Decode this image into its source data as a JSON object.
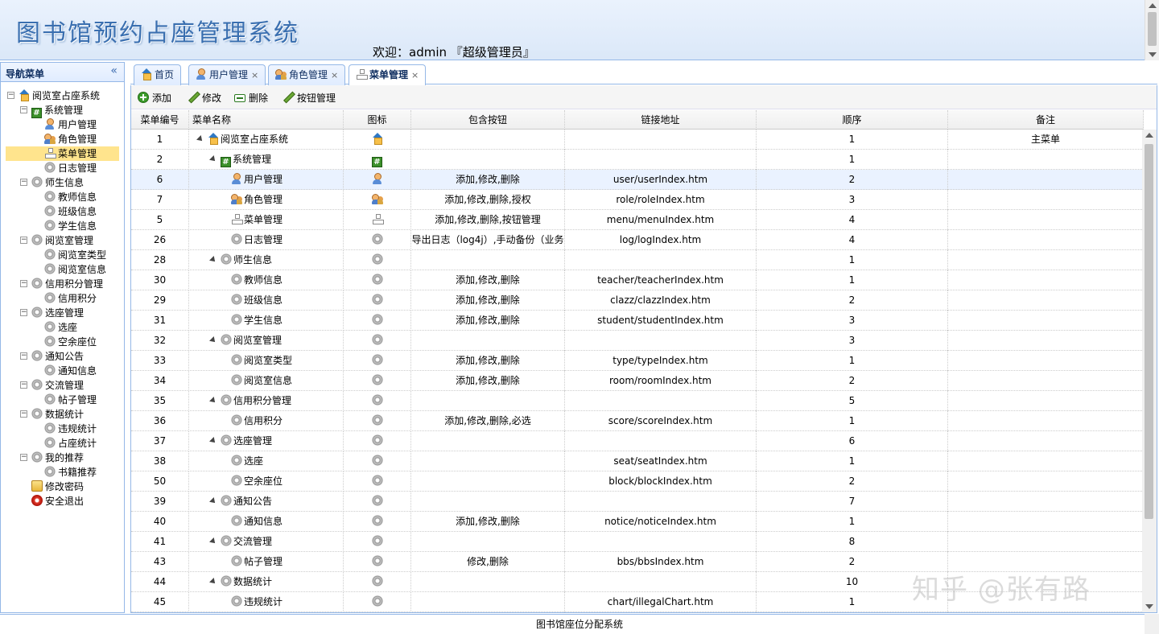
{
  "header": {
    "app_title": "图书馆预约占座管理系统",
    "welcome": "欢迎：admin 『超级管理员』"
  },
  "sidebar": {
    "title": "导航菜单",
    "collapse_glyph": "«",
    "nodes": [
      {
        "label": "阅览室占座系统",
        "icon": "home",
        "level": 0,
        "toggle": "−"
      },
      {
        "label": "系统管理",
        "icon": "hash",
        "level": 1,
        "toggle": "−"
      },
      {
        "label": "用户管理",
        "icon": "user",
        "level": 2
      },
      {
        "label": "角色管理",
        "icon": "role",
        "level": 2
      },
      {
        "label": "菜单管理",
        "icon": "menu",
        "level": 2,
        "selected": true
      },
      {
        "label": "日志管理",
        "icon": "gear",
        "level": 2
      },
      {
        "label": "师生信息",
        "icon": "gear",
        "level": 1,
        "toggle": "−"
      },
      {
        "label": "教师信息",
        "icon": "gear",
        "level": 2
      },
      {
        "label": "班级信息",
        "icon": "gear",
        "level": 2
      },
      {
        "label": "学生信息",
        "icon": "gear",
        "level": 2
      },
      {
        "label": "阅览室管理",
        "icon": "gear",
        "level": 1,
        "toggle": "−"
      },
      {
        "label": "阅览室类型",
        "icon": "gear",
        "level": 2
      },
      {
        "label": "阅览室信息",
        "icon": "gear",
        "level": 2
      },
      {
        "label": "信用积分管理",
        "icon": "gear",
        "level": 1,
        "toggle": "−"
      },
      {
        "label": "信用积分",
        "icon": "gear",
        "level": 2
      },
      {
        "label": "选座管理",
        "icon": "gear",
        "level": 1,
        "toggle": "−"
      },
      {
        "label": "选座",
        "icon": "gear",
        "level": 2
      },
      {
        "label": "空余座位",
        "icon": "gear",
        "level": 2
      },
      {
        "label": "通知公告",
        "icon": "gear",
        "level": 1,
        "toggle": "−"
      },
      {
        "label": "通知信息",
        "icon": "gear",
        "level": 2
      },
      {
        "label": "交流管理",
        "icon": "gear",
        "level": 1,
        "toggle": "−"
      },
      {
        "label": "帖子管理",
        "icon": "gear",
        "level": 2
      },
      {
        "label": "数据统计",
        "icon": "gear",
        "level": 1,
        "toggle": "−"
      },
      {
        "label": "违规统计",
        "icon": "gear",
        "level": 2
      },
      {
        "label": "占座统计",
        "icon": "gear",
        "level": 2
      },
      {
        "label": "我的推荐",
        "icon": "gear",
        "level": 1,
        "toggle": "−"
      },
      {
        "label": "书籍推荐",
        "icon": "gear",
        "level": 2
      },
      {
        "label": "修改密码",
        "icon": "key",
        "level": 1
      },
      {
        "label": "安全退出",
        "icon": "exit",
        "level": 1
      }
    ]
  },
  "tabs": [
    {
      "label": "首页",
      "icon": "home",
      "closable": false
    },
    {
      "label": "用户管理",
      "icon": "user",
      "closable": true
    },
    {
      "label": "角色管理",
      "icon": "role",
      "closable": true
    },
    {
      "label": "菜单管理",
      "icon": "menu",
      "closable": true,
      "active": true
    }
  ],
  "tab_close_glyph": "×",
  "toolbar": {
    "add": "添加",
    "edit": "修改",
    "delete": "删除",
    "button_manage": "按钮管理"
  },
  "grid": {
    "columns": [
      "菜单编号",
      "菜单名称",
      "图标",
      "包含按钮",
      "链接地址",
      "顺序",
      "备注"
    ],
    "rows": [
      {
        "id": "1",
        "name": "阅览室占座系统",
        "level": 0,
        "icon": "home",
        "buttons": "",
        "url": "",
        "order": "1",
        "remark": "主菜单",
        "expand": true
      },
      {
        "id": "2",
        "name": "系统管理",
        "level": 1,
        "icon": "hash",
        "buttons": "",
        "url": "",
        "order": "1",
        "remark": "",
        "expand": true
      },
      {
        "id": "6",
        "name": "用户管理",
        "level": 2,
        "icon": "user",
        "buttons": "添加,修改,删除",
        "url": "user/userIndex.htm",
        "order": "2",
        "remark": "",
        "highlight": true
      },
      {
        "id": "7",
        "name": "角色管理",
        "level": 2,
        "icon": "role",
        "buttons": "添加,修改,删除,授权",
        "url": "role/roleIndex.htm",
        "order": "3",
        "remark": ""
      },
      {
        "id": "5",
        "name": "菜单管理",
        "level": 2,
        "icon": "menu",
        "buttons": "添加,修改,删除,按钮管理",
        "url": "menu/menuIndex.htm",
        "order": "4",
        "remark": ""
      },
      {
        "id": "26",
        "name": "日志管理",
        "level": 2,
        "icon": "gear",
        "buttons": "导出日志（log4j）,手动备份（业务",
        "url": "log/logIndex.htm",
        "order": "4",
        "remark": ""
      },
      {
        "id": "28",
        "name": "师生信息",
        "level": 1,
        "icon": "gear",
        "buttons": "",
        "url": "",
        "order": "1",
        "remark": "",
        "expand": true
      },
      {
        "id": "30",
        "name": "教师信息",
        "level": 2,
        "icon": "gear",
        "buttons": "添加,修改,删除",
        "url": "teacher/teacherIndex.htm",
        "order": "1",
        "remark": ""
      },
      {
        "id": "29",
        "name": "班级信息",
        "level": 2,
        "icon": "gear",
        "buttons": "添加,修改,删除",
        "url": "clazz/clazzIndex.htm",
        "order": "2",
        "remark": ""
      },
      {
        "id": "31",
        "name": "学生信息",
        "level": 2,
        "icon": "gear",
        "buttons": "添加,修改,删除",
        "url": "student/studentIndex.htm",
        "order": "3",
        "remark": ""
      },
      {
        "id": "32",
        "name": "阅览室管理",
        "level": 1,
        "icon": "gear",
        "buttons": "",
        "url": "",
        "order": "3",
        "remark": "",
        "expand": true
      },
      {
        "id": "33",
        "name": "阅览室类型",
        "level": 2,
        "icon": "gear",
        "buttons": "添加,修改,删除",
        "url": "type/typeIndex.htm",
        "order": "1",
        "remark": ""
      },
      {
        "id": "34",
        "name": "阅览室信息",
        "level": 2,
        "icon": "gear",
        "buttons": "添加,修改,删除",
        "url": "room/roomIndex.htm",
        "order": "2",
        "remark": ""
      },
      {
        "id": "35",
        "name": "信用积分管理",
        "level": 1,
        "icon": "gear",
        "buttons": "",
        "url": "",
        "order": "5",
        "remark": "",
        "expand": true
      },
      {
        "id": "36",
        "name": "信用积分",
        "level": 2,
        "icon": "gear",
        "buttons": "添加,修改,删除,必选",
        "url": "score/scoreIndex.htm",
        "order": "1",
        "remark": ""
      },
      {
        "id": "37",
        "name": "选座管理",
        "level": 1,
        "icon": "gear",
        "buttons": "",
        "url": "",
        "order": "6",
        "remark": "",
        "expand": true
      },
      {
        "id": "38",
        "name": "选座",
        "level": 2,
        "icon": "gear",
        "buttons": "",
        "url": "seat/seatIndex.htm",
        "order": "1",
        "remark": ""
      },
      {
        "id": "50",
        "name": "空余座位",
        "level": 2,
        "icon": "gear",
        "buttons": "",
        "url": "block/blockIndex.htm",
        "order": "2",
        "remark": ""
      },
      {
        "id": "39",
        "name": "通知公告",
        "level": 1,
        "icon": "gear",
        "buttons": "",
        "url": "",
        "order": "7",
        "remark": "",
        "expand": true
      },
      {
        "id": "40",
        "name": "通知信息",
        "level": 2,
        "icon": "gear",
        "buttons": "添加,修改,删除",
        "url": "notice/noticeIndex.htm",
        "order": "1",
        "remark": ""
      },
      {
        "id": "41",
        "name": "交流管理",
        "level": 1,
        "icon": "gear",
        "buttons": "",
        "url": "",
        "order": "8",
        "remark": "",
        "expand": true
      },
      {
        "id": "43",
        "name": "帖子管理",
        "level": 2,
        "icon": "gear",
        "buttons": "修改,删除",
        "url": "bbs/bbsIndex.htm",
        "order": "2",
        "remark": ""
      },
      {
        "id": "44",
        "name": "数据统计",
        "level": 1,
        "icon": "gear",
        "buttons": "",
        "url": "",
        "order": "10",
        "remark": "",
        "expand": true
      },
      {
        "id": "45",
        "name": "违规统计",
        "level": 2,
        "icon": "gear",
        "buttons": "",
        "url": "chart/illegalChart.htm",
        "order": "1",
        "remark": ""
      }
    ]
  },
  "footer": {
    "text": "图书馆座位分配系统"
  },
  "watermark": "知乎 @张有路"
}
